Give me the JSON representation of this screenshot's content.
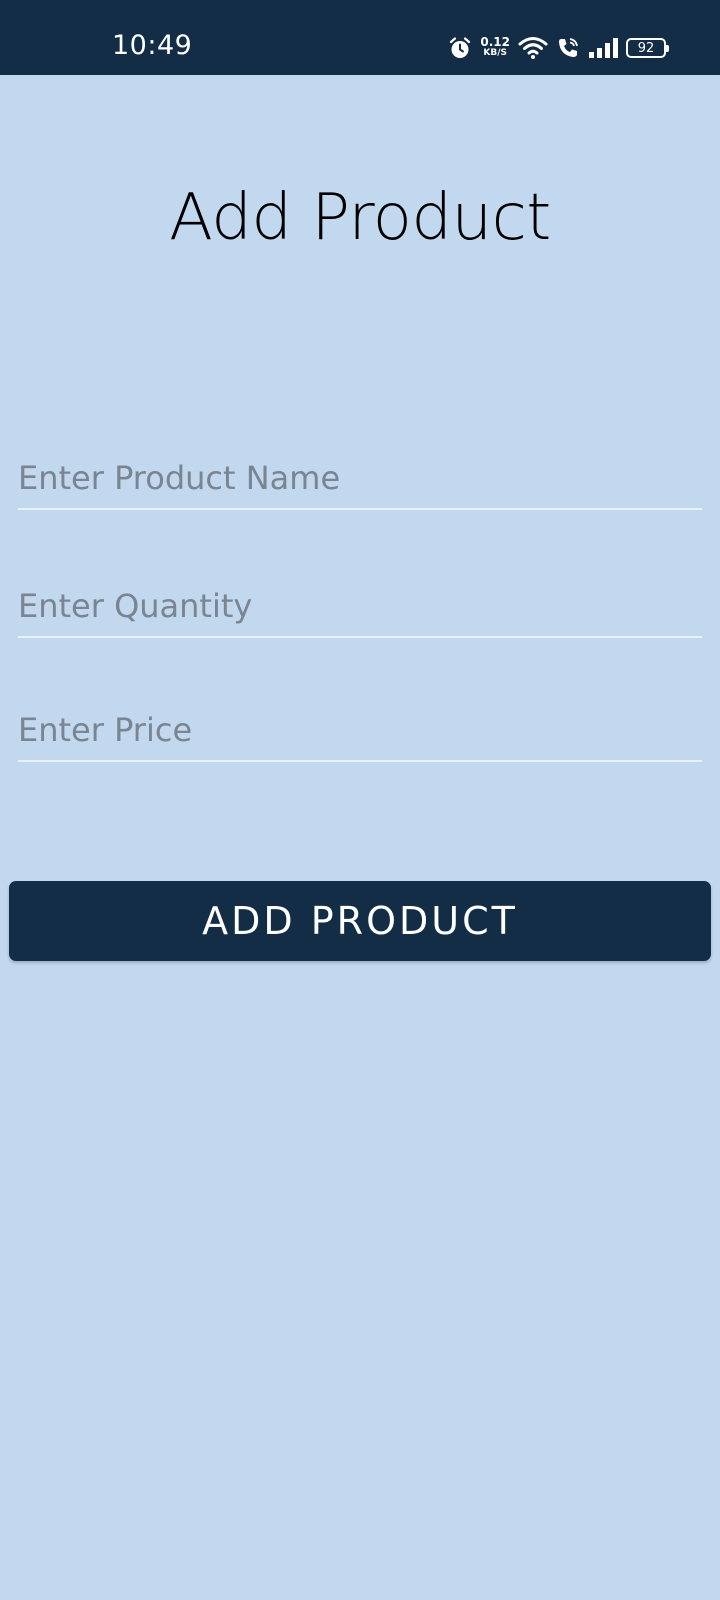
{
  "status_bar": {
    "time": "10:49",
    "net_speed_value": "0.12",
    "net_speed_unit": "KB/S",
    "battery_level": "92",
    "icons": [
      "alarm-icon",
      "wifi-icon",
      "call-icon",
      "signal-icon",
      "battery-icon"
    ],
    "background_color": "#142d47"
  },
  "page": {
    "title": "Add Product",
    "background_color": "#c2d8ee"
  },
  "form": {
    "product_name": {
      "value": "",
      "placeholder": "Enter Product Name"
    },
    "quantity": {
      "value": "",
      "placeholder": "Enter Quantity"
    },
    "price": {
      "value": "",
      "placeholder": "Enter Price"
    },
    "submit_label": "ADD PRODUCT"
  }
}
